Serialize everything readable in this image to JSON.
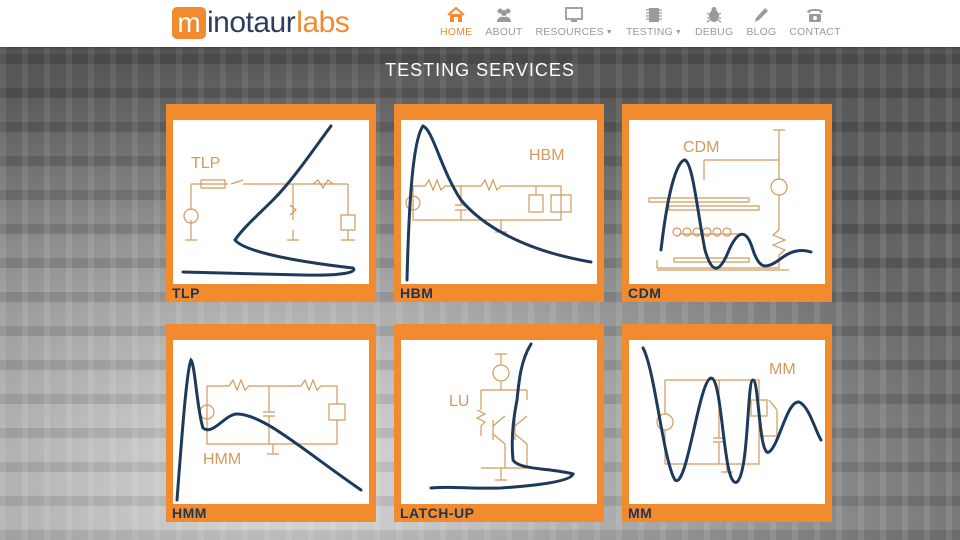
{
  "brand": {
    "part1": "m",
    "part2": "inotaur",
    "part3": "labs"
  },
  "nav": [
    {
      "label": "HOME",
      "icon": "home-icon",
      "dropdown": false,
      "active": true
    },
    {
      "label": "ABOUT",
      "icon": "people-icon",
      "dropdown": false,
      "active": false
    },
    {
      "label": "RESOURCES",
      "icon": "monitor-icon",
      "dropdown": true,
      "active": false
    },
    {
      "label": "TESTING",
      "icon": "chip-icon",
      "dropdown": true,
      "active": false
    },
    {
      "label": "DEBUG",
      "icon": "bug-icon",
      "dropdown": false,
      "active": false
    },
    {
      "label": "BLOG",
      "icon": "pencil-icon",
      "dropdown": false,
      "active": false
    },
    {
      "label": "CONTACT",
      "icon": "phone-icon",
      "dropdown": false,
      "active": false
    }
  ],
  "section": {
    "title": "TESTING SERVICES"
  },
  "cards": [
    {
      "label": "TLP",
      "diagram_text": "TLP"
    },
    {
      "label": "HBM",
      "diagram_text": "HBM"
    },
    {
      "label": "CDM",
      "diagram_text": "CDM"
    },
    {
      "label": "HMM",
      "diagram_text": "HMM"
    },
    {
      "label": "LATCH-UP",
      "diagram_text": "LU"
    },
    {
      "label": "MM",
      "diagram_text": "MM"
    }
  ],
  "colors": {
    "accent": "#f28a2e",
    "navy": "#1e3552",
    "circuit": "#d29a5c",
    "nav_text": "#9a9a9a"
  }
}
